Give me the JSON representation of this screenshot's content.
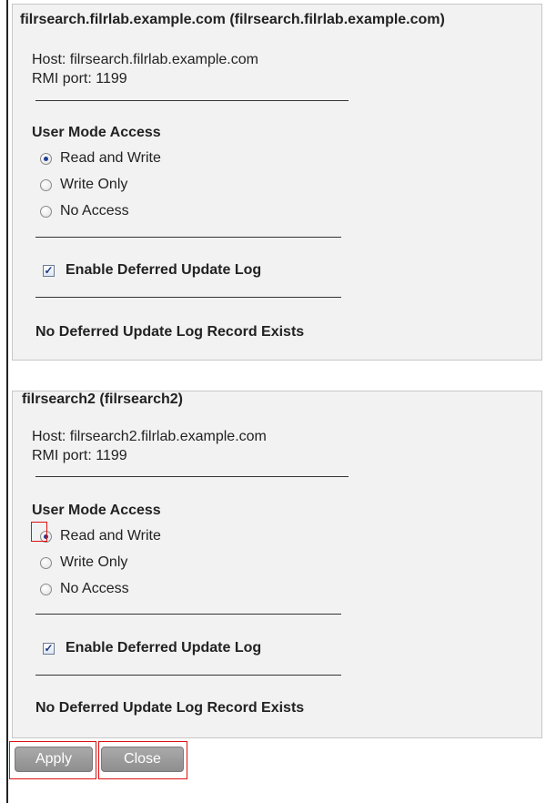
{
  "panels": [
    {
      "legend": "filrsearch.filrlab.example.com (filrsearch.filrlab.example.com)",
      "host_line": "Host: filrsearch.filrlab.example.com",
      "rmi_line": "RMI port: 1199",
      "access_title": "User Mode Access",
      "options": [
        "Read and Write",
        "Write Only",
        "No Access"
      ],
      "selected": "Read and Write",
      "deferred_label": "Enable Deferred Update Log",
      "deferred_checked": true,
      "deferred_status": "No Deferred Update Log Record Exists"
    },
    {
      "legend": "filrsearch2 (filrsearch2)",
      "host_line": "Host: filrsearch2.filrlab.example.com",
      "rmi_line": "RMI port: 1199",
      "access_title": "User Mode Access",
      "options": [
        "Read and Write",
        "Write Only",
        "No Access"
      ],
      "selected": "Read and Write",
      "deferred_label": "Enable Deferred Update Log",
      "deferred_checked": true,
      "deferred_status": "No Deferred Update Log Record Exists"
    }
  ],
  "buttons": {
    "apply": "Apply",
    "close": "Close"
  },
  "colors": {
    "panel_bg": "#f2f2f2",
    "highlight": "#dd1111",
    "button_bg": "#9a9a9a"
  }
}
